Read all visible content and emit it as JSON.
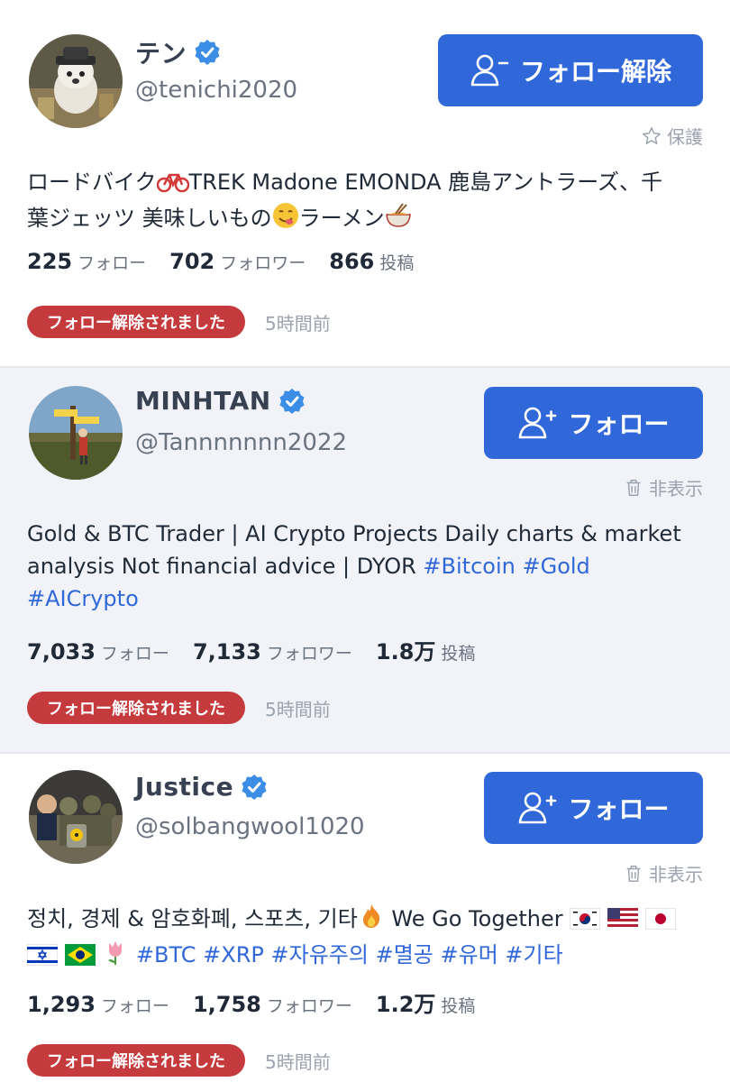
{
  "users": [
    {
      "name": "テン",
      "handle": "@tenichi2020",
      "button_label": "フォロー解除",
      "sub_action": "保護",
      "bio": {
        "p1": "ロードバイク",
        "p2": "TREK Madone EMONDA 鹿島アントラーズ、千",
        "p3": "葉ジェッツ 美味しいもの",
        "p4": "ラーメン"
      },
      "following": "225",
      "following_label": "フォロー",
      "followers": "702",
      "followers_label": "フォロワー",
      "posts": "866",
      "posts_label": "投稿",
      "status": "フォロー解除されました",
      "time": "5時間前"
    },
    {
      "name": "MINHTAN",
      "handle": "@Tannnnnnn2022",
      "button_label": "フォロー",
      "sub_action": "非表示",
      "bio": {
        "line1": "Gold & BTC Trader | AI Crypto Projects Daily charts & market",
        "line2": "analysis Not financial advice | DYOR ",
        "tag1": "#Bitcoin",
        "tag2": "#Gold",
        "tag3": "#AICrypto"
      },
      "following": "7,033",
      "following_label": "フォロー",
      "followers": "7,133",
      "followers_label": "フォロワー",
      "posts": "1.8万",
      "posts_label": "投稿",
      "status": "フォロー解除されました",
      "time": "5時間前"
    },
    {
      "name": "Justice",
      "handle": "@solbangwool1020",
      "button_label": "フォロー",
      "sub_action": "非表示",
      "bio": {
        "line1": "정치, 경제 & 암호화폐, 스포츠, 기타",
        "line1b": " We Go Together",
        "tags": [
          "#BTC",
          "#XRP",
          "#자유주의",
          "#멸공",
          "#유머",
          "#기타"
        ]
      },
      "following": "1,293",
      "following_label": "フォロー",
      "followers": "1,758",
      "followers_label": "フォロワー",
      "posts": "1.2万",
      "posts_label": "投稿",
      "status": "フォロー解除されました",
      "time": "5時間前"
    }
  ],
  "icons": {
    "verified": "verified-badge-icon",
    "unfollow": "person-minus-icon",
    "follow": "person-plus-icon",
    "protect": "star-outline-icon",
    "hide": "trash-icon"
  },
  "colors": {
    "accent": "#3168d9",
    "badge": "#c53a3c",
    "alt_bg": "#f1f3f8"
  }
}
